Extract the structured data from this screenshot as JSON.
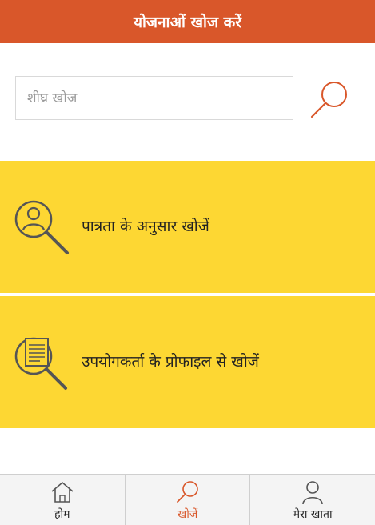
{
  "header": {
    "title": "योजनाओं खोज करें"
  },
  "search": {
    "placeholder": "शीघ्र खोज"
  },
  "cards": [
    {
      "label": "पात्रता के अनुसार खोजें",
      "icon": "person-search-icon"
    },
    {
      "label": "उपयोगकर्ता के प्रोफाइल से खोजें",
      "icon": "document-search-icon"
    }
  ],
  "nav": {
    "items": [
      {
        "label": "होम",
        "icon": "home-icon",
        "active": false
      },
      {
        "label": "खोजें",
        "icon": "search-icon",
        "active": true
      },
      {
        "label": "मेरा खाता",
        "icon": "user-icon",
        "active": false
      }
    ]
  },
  "colors": {
    "accent": "#d9572a",
    "card_bg": "#fdd733",
    "icon_gray": "#555555"
  }
}
